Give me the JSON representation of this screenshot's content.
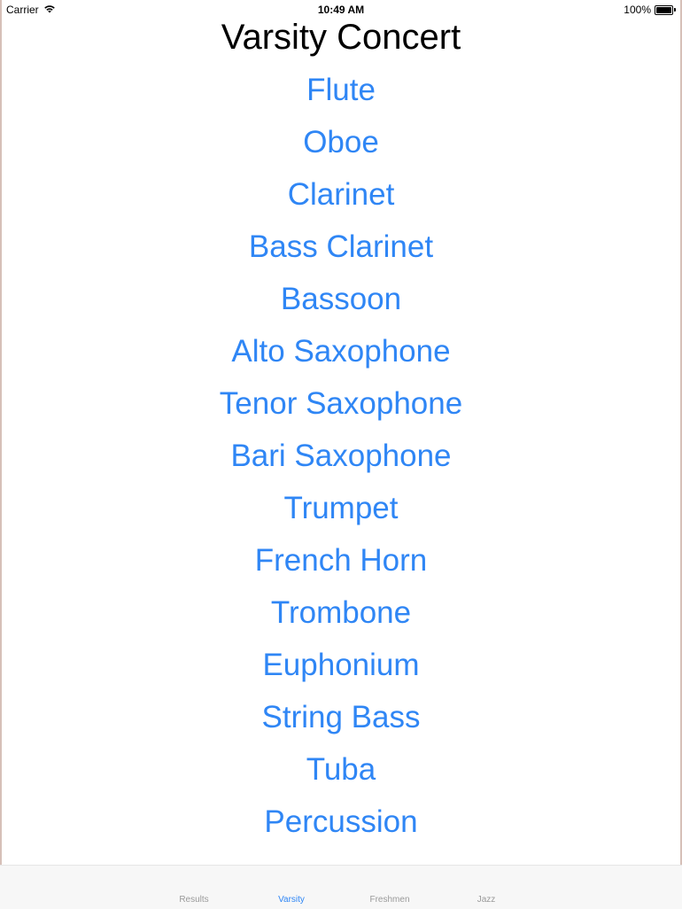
{
  "status_bar": {
    "carrier": "Carrier",
    "time": "10:49 AM",
    "battery": "100%",
    "battery_level": 1.0,
    "icons": [
      "wifi-icon",
      "battery-icon"
    ]
  },
  "title": "Varsity Concert",
  "instruments": [
    "Flute",
    "Oboe",
    "Clarinet",
    "Bass Clarinet",
    "Bassoon",
    "Alto Saxophone",
    "Tenor Saxophone",
    "Bari Saxophone",
    "Trumpet",
    "French Horn",
    "Trombone",
    "Euphonium",
    "String Bass",
    "Tuba",
    "Percussion"
  ],
  "tabs": [
    {
      "label": "Results",
      "active": false
    },
    {
      "label": "Varsity",
      "active": true
    },
    {
      "label": "Freshmen",
      "active": false
    },
    {
      "label": "Jazz",
      "active": false
    }
  ],
  "colors": {
    "accent": "#2f86f5",
    "tab_inactive": "#9a9a9a",
    "tab_bar_bg": "#f7f7f7"
  }
}
